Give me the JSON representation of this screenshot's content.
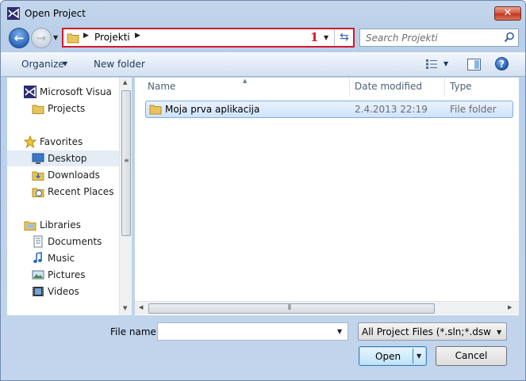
{
  "window": {
    "title": "Open Project"
  },
  "address": {
    "path_segment": "Projekti",
    "annotation": "1"
  },
  "search": {
    "placeholder": "Search Projekti"
  },
  "toolbar": {
    "organize_label": "Organize",
    "new_folder_label": "New folder"
  },
  "sidebar": {
    "items": [
      {
        "label": "Microsoft Visual St",
        "icon": "visual-studio-icon"
      },
      {
        "label": "Projects",
        "icon": "folder-icon"
      },
      {
        "label": "Favorites",
        "icon": "star-icon"
      },
      {
        "label": "Desktop",
        "icon": "desktop-icon"
      },
      {
        "label": "Downloads",
        "icon": "downloads-icon"
      },
      {
        "label": "Recent Places",
        "icon": "recent-places-icon"
      },
      {
        "label": "Libraries",
        "icon": "libraries-icon"
      },
      {
        "label": "Documents",
        "icon": "documents-icon"
      },
      {
        "label": "Music",
        "icon": "music-icon"
      },
      {
        "label": "Pictures",
        "icon": "pictures-icon"
      },
      {
        "label": "Videos",
        "icon": "videos-icon"
      }
    ]
  },
  "filelist": {
    "columns": [
      "Name",
      "Date modified",
      "Type"
    ],
    "rows": [
      {
        "name": "Moja prva aplikacija",
        "date": "2.4.2013 22:19",
        "type": "File folder"
      }
    ]
  },
  "bottom": {
    "file_name_label": "File name:",
    "file_name_value": "",
    "filter_value": "All Project Files (*.sln;*.dsw;*.vc",
    "open_label": "Open",
    "cancel_label": "Cancel"
  },
  "colors": {
    "accent": "#3c7fb1",
    "annotation": "#d6172b",
    "selection": "#cde3fb"
  }
}
